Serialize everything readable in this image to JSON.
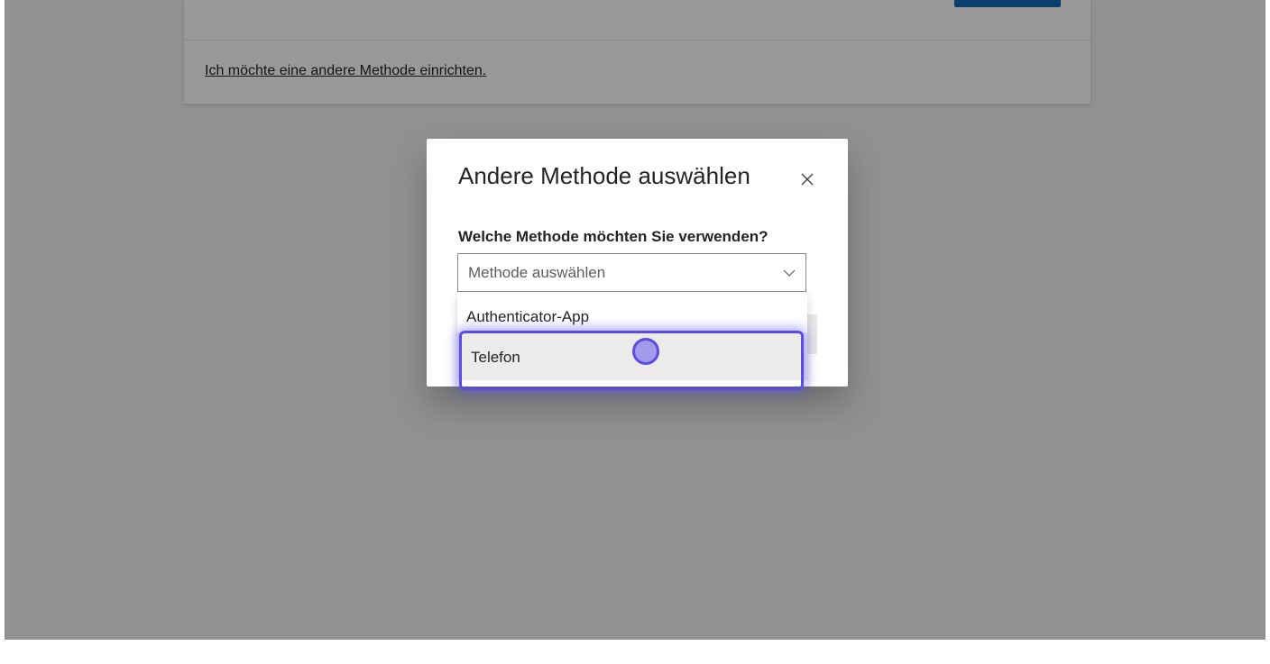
{
  "background_page": {
    "link_text": "Ich möchte eine andere Methode einrichten."
  },
  "dialog": {
    "title": "Andere Methode auswählen",
    "close_icon": "close-icon",
    "question_label": "Welche Methode möchten Sie verwenden?",
    "select": {
      "placeholder": "Methode auswählen",
      "chevron_icon": "chevron-down-icon"
    },
    "options": [
      {
        "label": "Authenticator-App"
      },
      {
        "label": "Telefon"
      }
    ]
  },
  "colors": {
    "brand_primary": "#0f6cbd",
    "highlight_ring": "#5b4de0",
    "option_hover": "#edebe9"
  }
}
